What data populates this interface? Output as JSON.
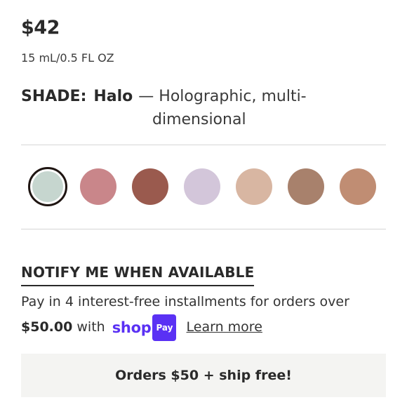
{
  "product": {
    "price": "$42",
    "size": "15 mL/0.5 FL OZ"
  },
  "shade": {
    "label": "SHADE:",
    "name": "Halo",
    "description_line1": "— Holographic, multi-",
    "description_line2": "dimensional"
  },
  "swatches": [
    {
      "color": "#c6d6cf",
      "selected": true
    },
    {
      "color": "#c9868a",
      "selected": false
    },
    {
      "color": "#9a5a4e",
      "selected": false
    },
    {
      "color": "#d3c6da",
      "selected": false
    },
    {
      "color": "#d8b6a2",
      "selected": false
    },
    {
      "color": "#a8816c",
      "selected": false
    },
    {
      "color": "#c08d73",
      "selected": false
    }
  ],
  "notify": {
    "label": "NOTIFY ME WHEN AVAILABLE"
  },
  "installments": {
    "text_before": "Pay in 4 interest-free installments for orders over",
    "amount": "$50.00",
    "text_with": "with",
    "shop_word": "shop",
    "pay_word": "Pay",
    "learn_more": "Learn more"
  },
  "promo": {
    "text": "Orders $50 + ship free!"
  },
  "colors": {
    "shop_pay_purple": "#5a31f4",
    "selected_ring": "#1f1512",
    "promo_bg": "#f4f4f2"
  }
}
